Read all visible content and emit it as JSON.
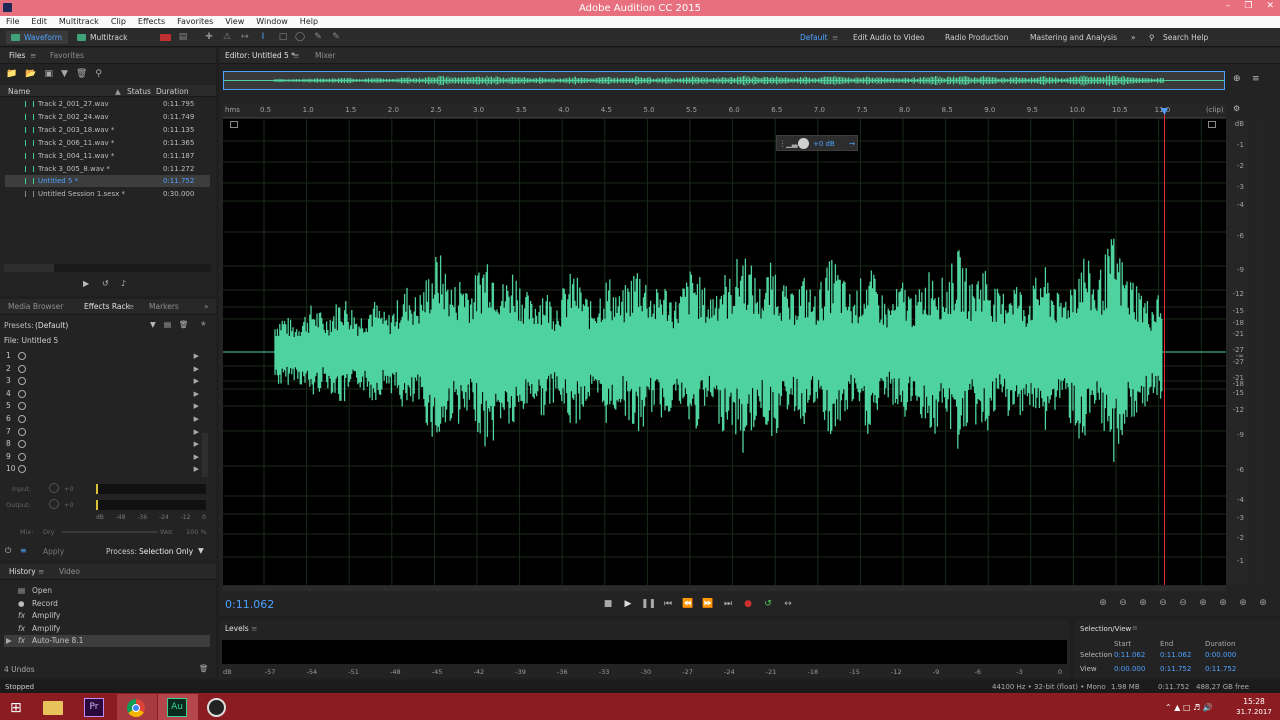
{
  "app_title": "Adobe Audition CC 2015",
  "menu": [
    "File",
    "Edit",
    "Multitrack",
    "Clip",
    "Effects",
    "Favorites",
    "View",
    "Window",
    "Help"
  ],
  "toolbar": {
    "waveform_label": "Waveform",
    "multitrack_label": "Multitrack",
    "workspaces": [
      "Default",
      "Edit Audio to Video",
      "Radio Production",
      "Mastering and Analysis"
    ],
    "more": "»",
    "search_placeholder": "Search Help"
  },
  "files_panel": {
    "tabs": [
      "Files",
      "Favorites"
    ],
    "columns": {
      "name": "Name",
      "status": "Status",
      "duration": "Duration"
    },
    "rows": [
      {
        "name": "Track 2_001_27.wav",
        "duration": "0:11.795"
      },
      {
        "name": "Track 2_002_24.wav",
        "duration": "0:11.749"
      },
      {
        "name": "Track 2_003_18.wav *",
        "duration": "0:11.135"
      },
      {
        "name": "Track 2_006_11.wav *",
        "duration": "0:11.365"
      },
      {
        "name": "Track 3_004_11.wav *",
        "duration": "0:11.187"
      },
      {
        "name": "Track 3_005_8.wav *",
        "duration": "0:11.272"
      },
      {
        "name": "Untitled 5 *",
        "duration": "0:11.752",
        "selected": true
      },
      {
        "name": "Untitled Session 1.sesx *",
        "duration": "0:30.000"
      }
    ]
  },
  "effects_panel": {
    "tabs": [
      "Media Browser",
      "Effects Rack",
      "Markers"
    ],
    "presets_label": "Presets:",
    "presets_value": "(Default)",
    "file_label": "File: Untitled 5",
    "slots": [
      "1",
      "2",
      "3",
      "4",
      "5",
      "6",
      "7",
      "8",
      "9",
      "10"
    ],
    "input_label": "Input:",
    "input_value": "+0",
    "output_label": "Output:",
    "output_value": "+0",
    "meter_ticks": [
      "dB",
      "-48",
      "-36",
      "-24",
      "-12",
      "0"
    ],
    "mix_label": "Mix:",
    "dry_label": "Dry",
    "wet_label": "Wet",
    "wet_value": "100 %",
    "apply_label": "Apply",
    "process_label": "Process:",
    "process_value": "Selection Only"
  },
  "history_panel": {
    "tabs": [
      "History",
      "Video"
    ],
    "items": [
      {
        "label": "Open",
        "icon": "document-icon"
      },
      {
        "label": "Record",
        "icon": "record-dot-icon"
      },
      {
        "label": "Amplify",
        "icon": "fx-icon"
      },
      {
        "label": "Amplify",
        "icon": "fx-icon"
      },
      {
        "label": "Auto-Tune 8.1",
        "icon": "fx-icon",
        "selected": true
      }
    ],
    "undos": "4 Undos"
  },
  "editor": {
    "tab_label": "Editor: Untitled 5 *",
    "mixer_label": "Mixer",
    "time_unit": "hms",
    "clip_label": "(clip)",
    "time_ticks": [
      "0.5",
      "1.0",
      "1.5",
      "2.0",
      "2.5",
      "3.0",
      "3.5",
      "4.0",
      "4.5",
      "5.0",
      "5.5",
      "6.0",
      "6.5",
      "7.0",
      "7.5",
      "8.0",
      "8.5",
      "9.0",
      "9.5",
      "10.0",
      "10.5",
      "11.0"
    ],
    "db_ticks": [
      "dB",
      "-1",
      "-2",
      "-3",
      "-4",
      "-6",
      "-9",
      "-12",
      "-15",
      "-18",
      "-21",
      "-27",
      "-∞",
      "-27",
      "-21",
      "-18",
      "-15",
      "-12",
      "-9",
      "-6",
      "-4",
      "-3",
      "-2",
      "-1"
    ],
    "hud_gain": "+0 dB",
    "current_time": "0:11.062",
    "waveform_color": "#4fd39e",
    "playhead_color": "#e03030"
  },
  "levels_panel": {
    "title": "Levels",
    "ticks": [
      "dB",
      "-57",
      "-54",
      "-51",
      "-48",
      "-45",
      "-42",
      "-39",
      "-36",
      "-33",
      "-30",
      "-27",
      "-24",
      "-21",
      "-18",
      "-15",
      "-12",
      "-9",
      "-6",
      "-3",
      "0"
    ]
  },
  "selection_view": {
    "title": "Selection/View",
    "headers": [
      "Start",
      "End",
      "Duration"
    ],
    "selection_label": "Selection",
    "selection": [
      "0:11.062",
      "0:11.062",
      "0:00.000"
    ],
    "view_label": "View",
    "view": [
      "0:00.000",
      "0:11.752",
      "0:11.752"
    ]
  },
  "status_bar": {
    "left": "Stopped",
    "format": "44100 Hz • 32-bit (float) • Mono",
    "size": "1.98 MB",
    "duration": "0:11.752",
    "free": "488,27 GB free"
  },
  "taskbar": {
    "time": "15:28",
    "date": "31.7.2017",
    "apps": [
      "windows-start-icon",
      "file-explorer-icon",
      "premiere-pro-icon",
      "chrome-icon",
      "audition-icon",
      "obs-icon"
    ]
  }
}
